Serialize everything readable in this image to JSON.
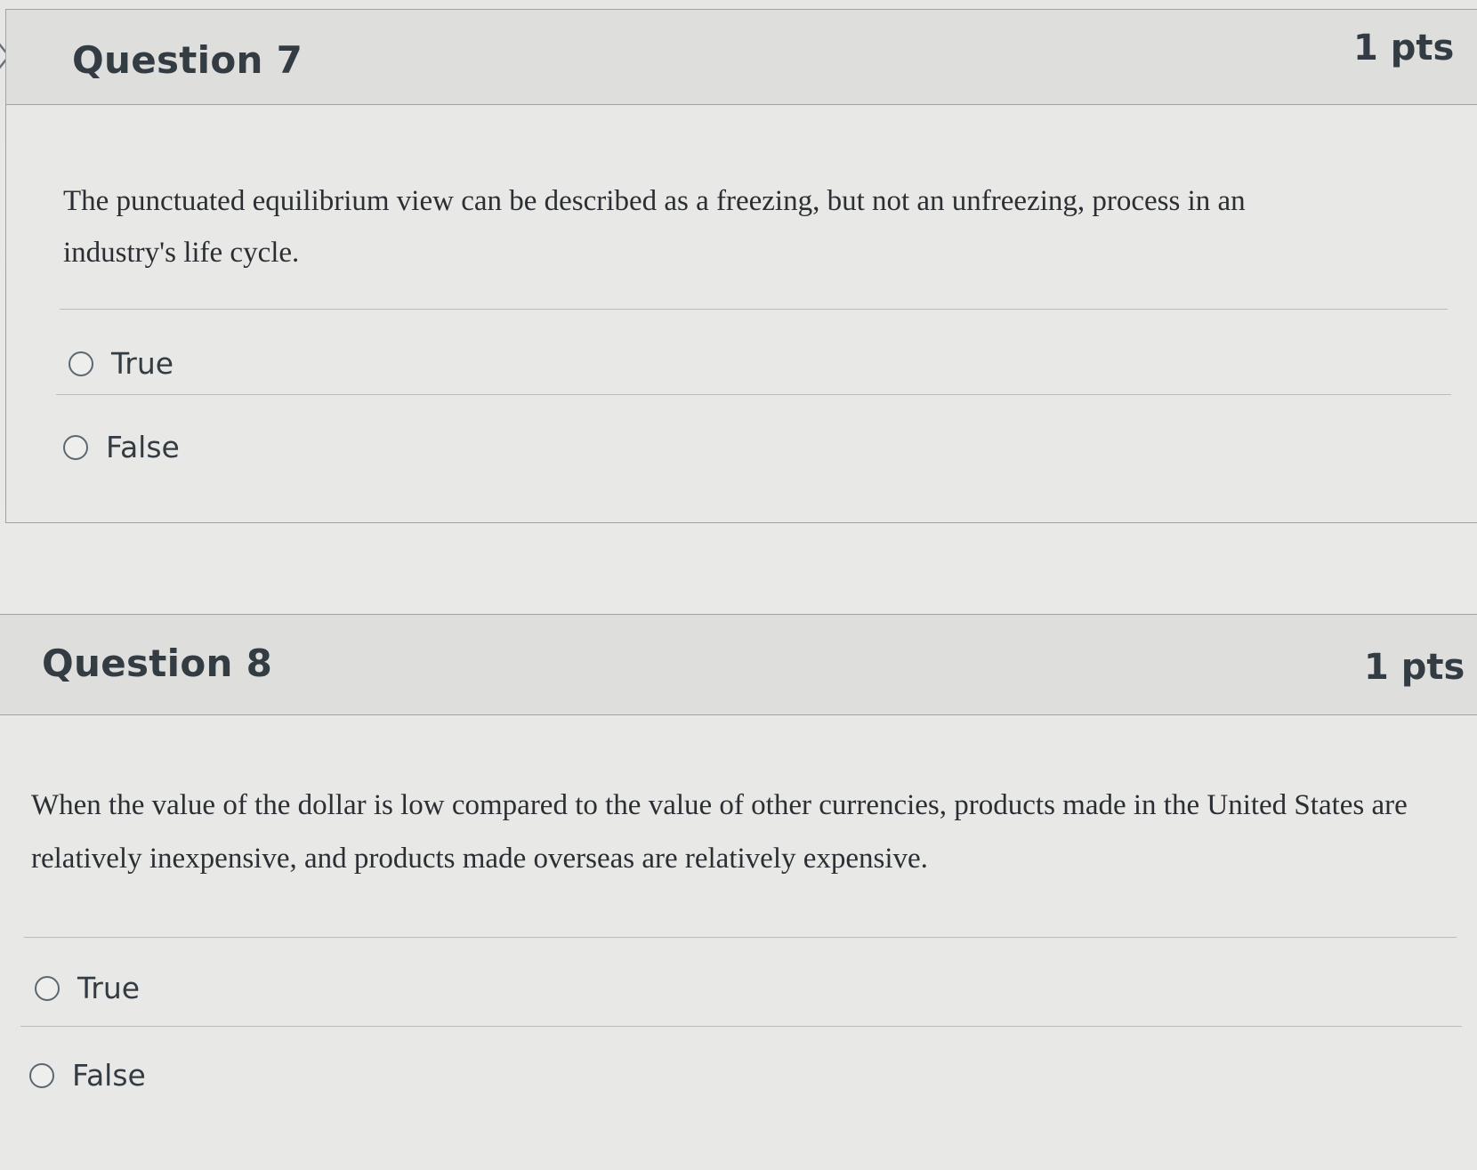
{
  "questions": [
    {
      "title": "Question 7",
      "points": "1 pts",
      "text": "The punctuated equilibrium view can be described as a freezing, but not an unfreezing, process in an industry's life cycle.",
      "answers": [
        {
          "label": "True"
        },
        {
          "label": "False"
        }
      ]
    },
    {
      "title": "Question 8",
      "points": "1 pts",
      "text": "When the value of the dollar is low compared to the value of other currencies, products made in the United States are relatively inexpensive, and products made overseas are relatively expensive.",
      "answers": [
        {
          "label": "True"
        },
        {
          "label": "False"
        }
      ]
    }
  ]
}
